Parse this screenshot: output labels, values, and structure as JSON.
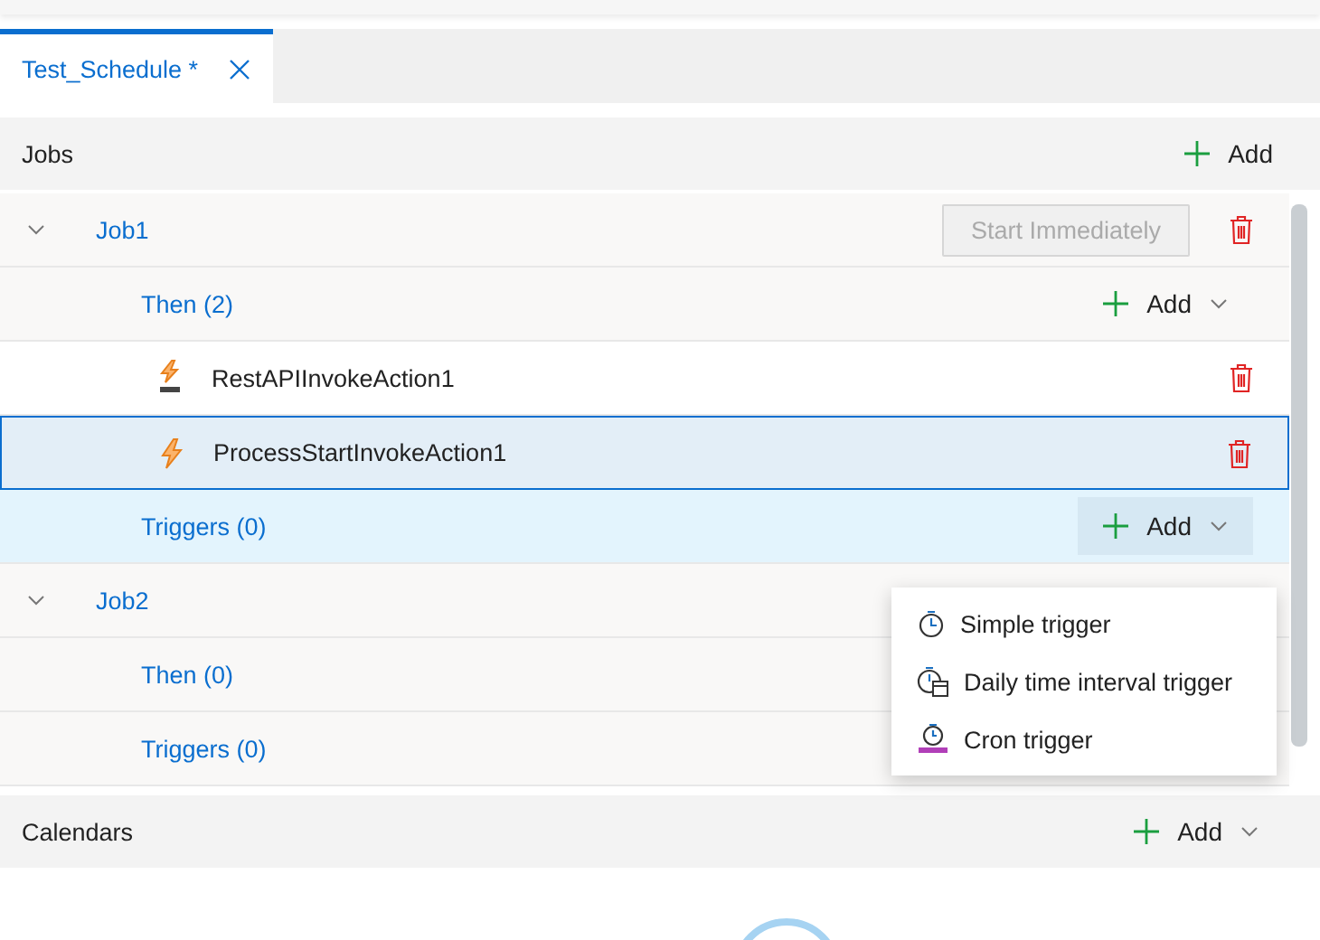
{
  "tab": {
    "label": "Test_Schedule *",
    "selected": true
  },
  "jobs": {
    "title": "Jobs",
    "add_label": "Add",
    "items": [
      {
        "name": "Job1",
        "expanded": true,
        "start_button": {
          "label": "Start Immediately",
          "disabled": true
        },
        "then": {
          "label": "Then (2)",
          "add_label": "Add",
          "actions": [
            {
              "name": "RestAPIInvokeAction1",
              "kind": "rest",
              "selected": false
            },
            {
              "name": "ProcessStartInvokeAction1",
              "kind": "process",
              "selected": true
            }
          ]
        },
        "triggers": {
          "label": "Triggers (0)",
          "add_label": "Add",
          "highlighted": true
        }
      },
      {
        "name": "Job2",
        "expanded": true,
        "then": {
          "label": "Then (0)"
        },
        "triggers": {
          "label": "Triggers (0)",
          "highlighted": false
        }
      }
    ]
  },
  "menu": {
    "items": [
      {
        "label": "Simple trigger",
        "kind": "simple"
      },
      {
        "label": "Daily time interval trigger",
        "kind": "daily"
      },
      {
        "label": "Cron trigger",
        "kind": "cron"
      }
    ]
  },
  "calendars": {
    "title": "Calendars",
    "add_label": "Add"
  }
}
